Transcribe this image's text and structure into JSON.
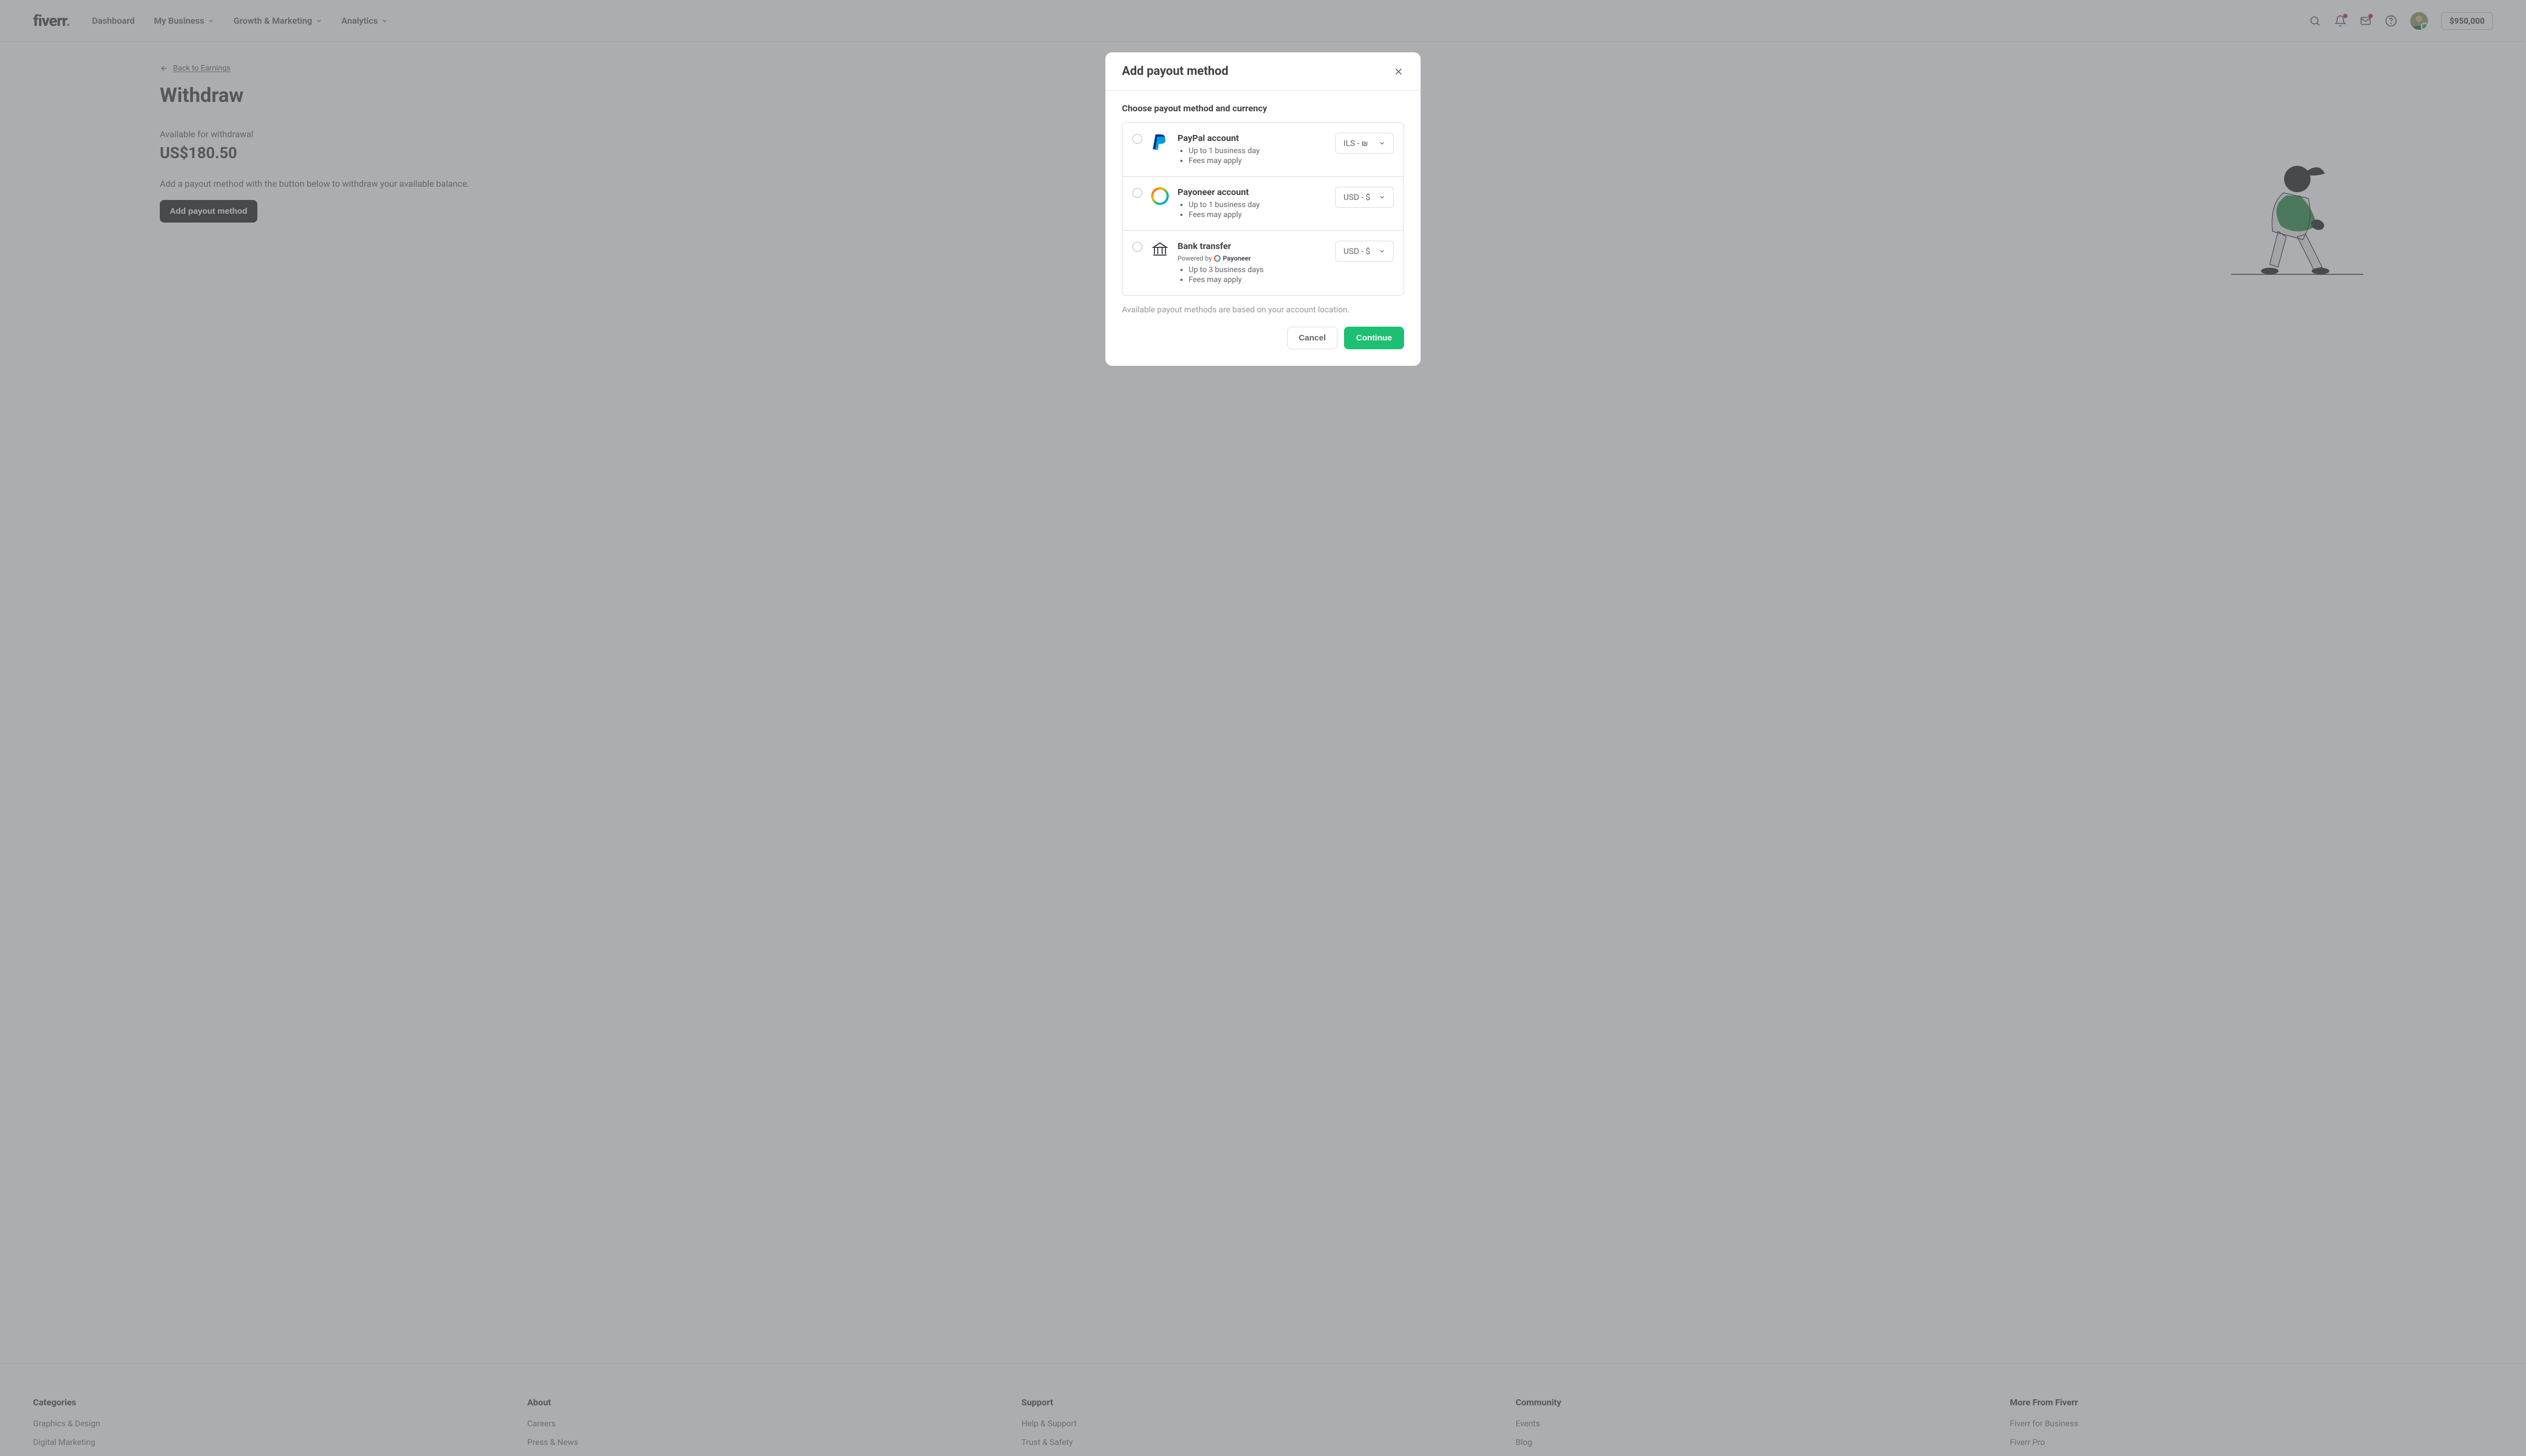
{
  "header": {
    "logo_text": "fiverr",
    "nav": [
      "Dashboard",
      "My Business",
      "Growth & Marketing",
      "Analytics"
    ],
    "balance": "$950,000"
  },
  "page": {
    "back_link": "Back to Earnings",
    "title": "Withdraw",
    "available_label": "Available for withdrawal",
    "amount": "US$180.50",
    "hint": "Add a payout method with the button below to withdraw your available balance.",
    "add_button": "Add payout method"
  },
  "modal": {
    "title": "Add payout method",
    "subtitle": "Choose payout method and currency",
    "options": [
      {
        "name": "PayPal account",
        "bullets": [
          "Up to 1 business day",
          "Fees may apply"
        ],
        "currency": "ILS - ₪"
      },
      {
        "name": "Payoneer account",
        "bullets": [
          "Up to 1 business day",
          "Fees may apply"
        ],
        "currency": "USD - $"
      },
      {
        "name": "Bank transfer",
        "powered": "Powered by",
        "powered_brand": "Payoneer",
        "bullets": [
          "Up to 3 business days",
          "Fees may apply"
        ],
        "currency": "USD - $"
      }
    ],
    "note": "Available payout methods are based on your account location.",
    "cancel": "Cancel",
    "continue": "Continue"
  },
  "footer": {
    "cols": [
      {
        "title": "Categories",
        "links": [
          "Graphics & Design",
          "Digital Marketing"
        ]
      },
      {
        "title": "About",
        "links": [
          "Careers",
          "Press & News"
        ]
      },
      {
        "title": "Support",
        "links": [
          "Help & Support",
          "Trust & Safety"
        ]
      },
      {
        "title": "Community",
        "links": [
          "Events",
          "Blog"
        ]
      },
      {
        "title": "More From Fiverr",
        "links": [
          "Fiverr for Business",
          "Fiverr Pro"
        ]
      }
    ]
  }
}
